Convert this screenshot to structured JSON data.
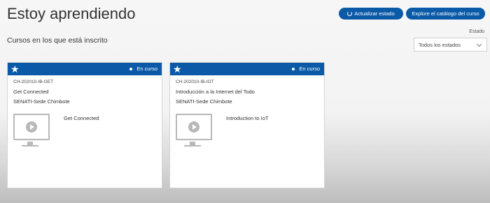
{
  "page": {
    "title": "Estoy aprendiendo",
    "subtitle": "Cursos en los que está inscrito"
  },
  "toolbar": {
    "refresh_label": "Actualizar estado",
    "catalog_label": "Explore el catálogo del curso"
  },
  "filter": {
    "label": "Estado",
    "selected": "Todos los estados"
  },
  "courses": [
    {
      "status": "En curso",
      "code": "CH-202010-IB-GET",
      "name": "Get Connected",
      "institution": "SENATI-Sede Chimbote",
      "media_title": "Get Connected"
    },
    {
      "status": "En curso",
      "code": "CH-202010-IB-IOT",
      "name": "Introducción a la Internet del Todo",
      "institution": "SENATI-Sede Chimbote",
      "media_title": "Introduction to IoT"
    }
  ],
  "colors": {
    "accent": "#0a5aa8"
  }
}
